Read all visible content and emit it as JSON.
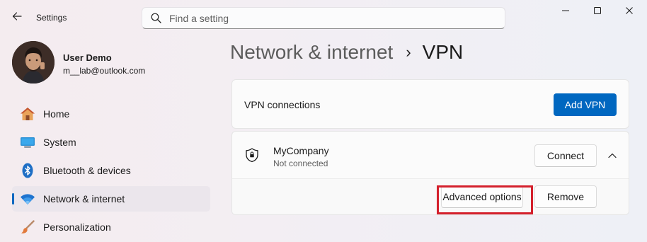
{
  "window": {
    "app_title": "Settings",
    "search_placeholder": "Find a setting"
  },
  "profile": {
    "name": "User Demo",
    "email": "m__lab@outlook.com"
  },
  "sidebar": {
    "items": [
      {
        "label": "Home",
        "icon": "home-icon",
        "active": false
      },
      {
        "label": "System",
        "icon": "system-icon",
        "active": false
      },
      {
        "label": "Bluetooth & devices",
        "icon": "bluetooth-icon",
        "active": false
      },
      {
        "label": "Network & internet",
        "icon": "wifi-icon",
        "active": true
      },
      {
        "label": "Personalization",
        "icon": "brush-icon",
        "active": false
      }
    ]
  },
  "breadcrumb": {
    "parent": "Network & internet",
    "separator": "›",
    "current": "VPN"
  },
  "vpn_card": {
    "label": "VPN connections",
    "add_button": "Add VPN"
  },
  "connection": {
    "name": "MyCompany",
    "status": "Not connected",
    "connect_button": "Connect",
    "advanced_button": "Advanced options",
    "remove_button": "Remove"
  },
  "colors": {
    "accent": "#0067c0",
    "highlight": "#d4202c"
  }
}
